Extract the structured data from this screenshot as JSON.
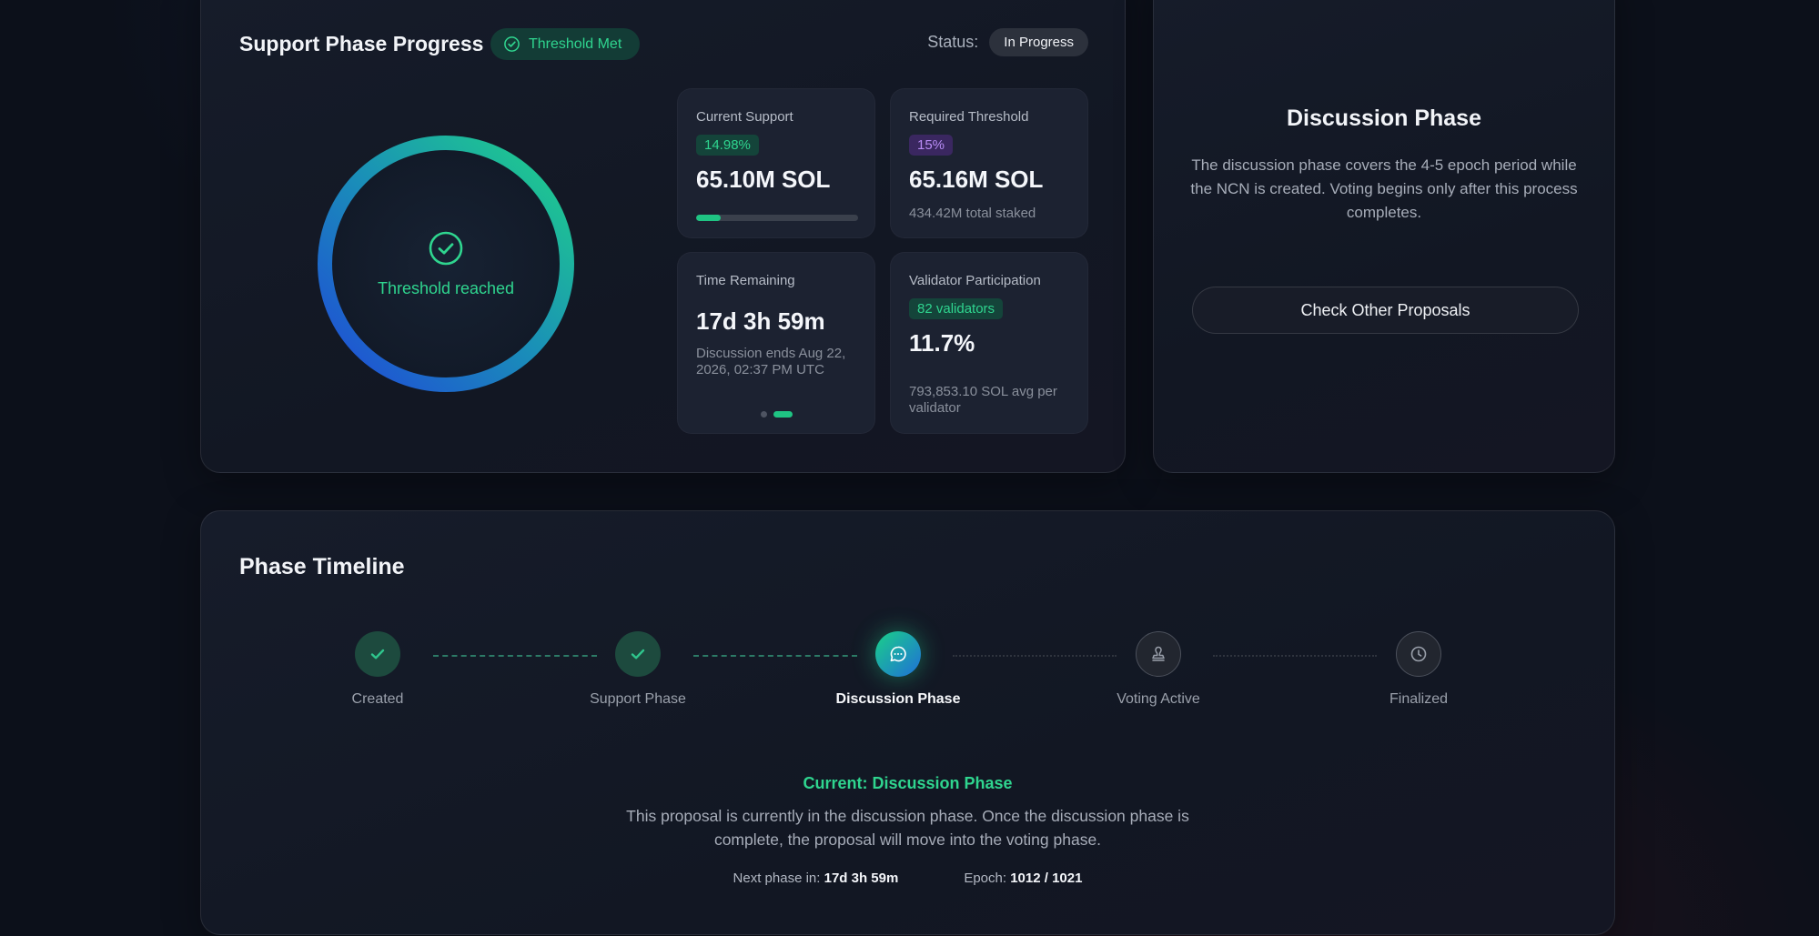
{
  "support_card": {
    "title": "Support Phase Progress",
    "threshold_badge": "Threshold Met",
    "status_label": "Status:",
    "status_value": "In Progress",
    "ring_text": "Threshold reached",
    "stats": {
      "current_support": {
        "label": "Current Support",
        "chip": "14.98%",
        "value": "65.10M SOL",
        "progress_fraction": 0.15
      },
      "required_threshold": {
        "label": "Required Threshold",
        "chip": "15%",
        "value": "65.16M SOL",
        "sub": "434.42M total staked"
      },
      "time_remaining": {
        "label": "Time Remaining",
        "value": "17d 3h 59m",
        "sub": "Discussion ends Aug 22, 2026, 02:37 PM UTC"
      },
      "validator_participation": {
        "label": "Validator Participation",
        "chip": "82 validators",
        "value": "11.7%",
        "sub": "793,853.10 SOL avg per validator"
      }
    }
  },
  "discussion_card": {
    "title": "Discussion Phase",
    "description": "The discussion phase covers the 4-5 epoch period while the NCN is created. Voting begins only after this process completes.",
    "button_label": "Check Other Proposals"
  },
  "timeline": {
    "title": "Phase Timeline",
    "steps": [
      {
        "label": "Created",
        "state": "done"
      },
      {
        "label": "Support Phase",
        "state": "done"
      },
      {
        "label": "Discussion Phase",
        "state": "current"
      },
      {
        "label": "Voting Active",
        "state": "pending"
      },
      {
        "label": "Finalized",
        "state": "pending"
      }
    ],
    "current_title": "Current: Discussion Phase",
    "current_description": "This proposal is currently in the discussion phase. Once the discussion phase is complete, the proposal will move into the voting phase.",
    "next_phase_label": "Next phase in:",
    "next_phase_value": "17d 3h 59m",
    "epoch_label": "Epoch:",
    "epoch_value": "1012 / 1021"
  },
  "colors": {
    "accent_green": "#2fd58f",
    "accent_blue": "#1f5fd8",
    "purple": "#b88cf5"
  }
}
